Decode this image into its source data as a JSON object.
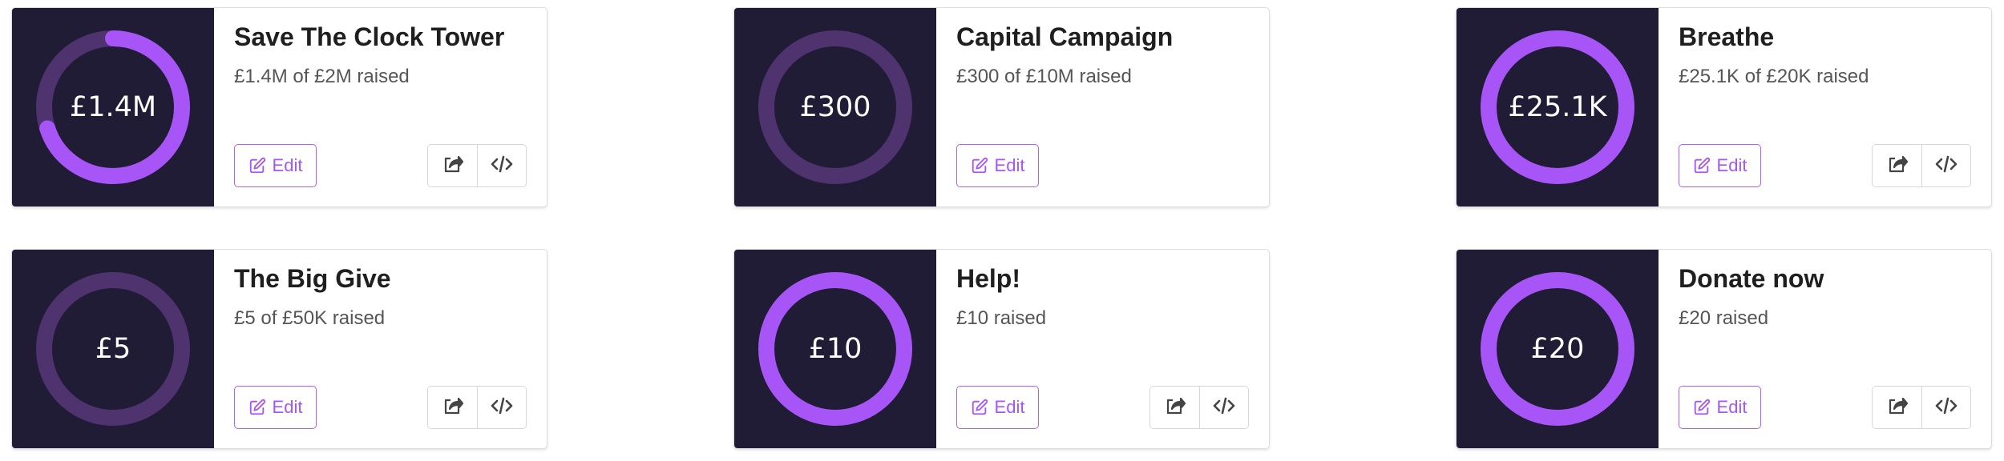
{
  "colors": {
    "thumb_bg": "#201c35",
    "ring_track": "#4f336f",
    "ring_fill": "#a855f7",
    "accent": "#a855f7"
  },
  "actions": {
    "edit_label": "Edit",
    "edit_icon": "pencil-square-icon",
    "share_icon": "share-icon",
    "embed_icon": "code-icon"
  },
  "campaigns": [
    {
      "title": "Save The Clock Tower",
      "subtitle": "£1.4M of £2M raised",
      "ring_label": "£1.4M",
      "progress": 0.7
    },
    {
      "title": "Capital Campaign",
      "subtitle": "£300 of £10M raised",
      "ring_label": "£300",
      "progress": 0.0
    },
    {
      "title": "Breathe",
      "subtitle": "£25.1K of £20K raised",
      "ring_label": "£25.1K",
      "progress": 1.0
    },
    {
      "title": "The Big Give",
      "subtitle": "£5 of £50K raised",
      "ring_label": "£5",
      "progress": 0.0
    },
    {
      "title": "Help!",
      "subtitle": "£10 raised",
      "ring_label": "£10",
      "progress": 1.0
    },
    {
      "title": "Donate now",
      "subtitle": "£20 raised",
      "ring_label": "£20",
      "progress": 1.0
    }
  ]
}
